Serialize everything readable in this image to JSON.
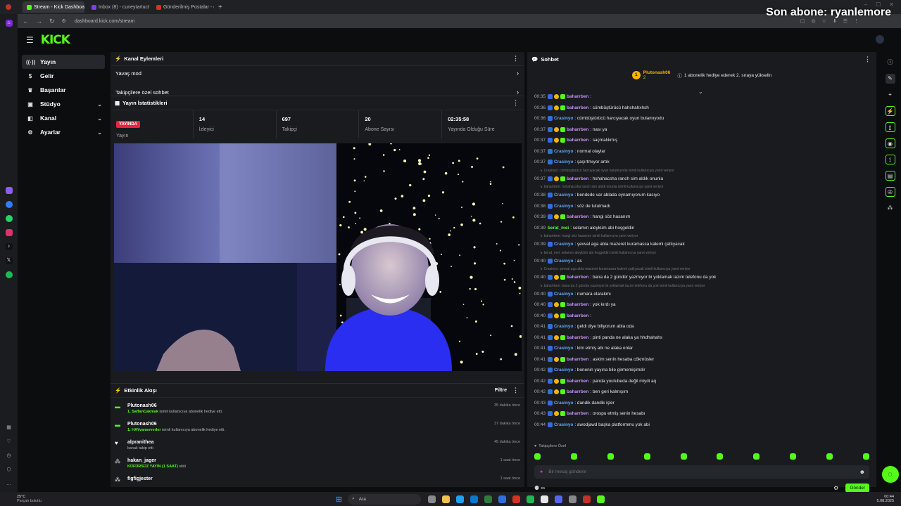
{
  "browser": {
    "tabs": [
      {
        "title": "Stream - Kick Dashboard",
        "color": "#53fc18",
        "active": true
      },
      {
        "title": "Inbox (8) - cuneytartuc81:",
        "color": "#7e3ff2",
        "active": false
      },
      {
        "title": "Gönderilmiş Postalar - cun",
        "color": "#d93025",
        "active": false
      }
    ],
    "url": "dashboard.kick.com/stream"
  },
  "overlay_text": "Son abone: ryanlemore",
  "header": {
    "logo": "KICK"
  },
  "leftnav": {
    "items": [
      {
        "label": "Yayın",
        "icon": "broadcast-icon",
        "active": true
      },
      {
        "label": "Gelir",
        "icon": "revenue-icon"
      },
      {
        "label": "Başarılar",
        "icon": "trophy-icon"
      },
      {
        "label": "Stüdyo",
        "icon": "studio-icon",
        "chevron": true
      },
      {
        "label": "Kanal",
        "icon": "channel-icon",
        "chevron": true
      },
      {
        "label": "Ayarlar",
        "icon": "settings-icon",
        "chevron": true
      }
    ]
  },
  "channel_actions": {
    "title": "Kanal Eylemleri",
    "items": [
      "Yavaş mod",
      "Takipçilere özel sohbet"
    ]
  },
  "stream_stats": {
    "title": "Yayın İstatistikleri",
    "status": "YAYINDA",
    "stats": [
      {
        "value": "",
        "label": "Yayın"
      },
      {
        "value": "14",
        "label": "İzleyici"
      },
      {
        "value": "697",
        "label": "Takipçi"
      },
      {
        "value": "20",
        "label": "Abone Sayısı"
      },
      {
        "value": "02:35:58",
        "label": "Yayında Olduğu Süre"
      }
    ]
  },
  "activity": {
    "title": "Etkinlik Akışı",
    "filter": "Filtre",
    "items": [
      {
        "name": "Plutonash06",
        "desc_strong": "1, SaffanCakmak",
        "desc": " isimli kullanıcıya abonelik hediye etti.",
        "time": "35 dakika önce",
        "icon": "gift-icon"
      },
      {
        "name": "Plutonash06",
        "desc_strong": "1, HAYvanseverler",
        "desc": " isimli kullanıcıya abonelik hediye etti.",
        "time": "37 dakika önce",
        "icon": "gift-icon"
      },
      {
        "name": "alpranithea",
        "desc_strong": "",
        "desc": "kanalı takip etti",
        "time": "45 dakika önce",
        "icon": "heart-icon"
      },
      {
        "name": "hakan_jager",
        "desc_strong": "KÜFÜRSÜZ YAYIN (1 SAAT)",
        "desc": " sildi",
        "time": "1 saat önce",
        "icon": "reward-icon"
      },
      {
        "name": "figfigjester",
        "desc_strong": "",
        "desc": "",
        "time": "1 saat önce",
        "icon": "reward-icon"
      }
    ]
  },
  "chat": {
    "title": "Sohbet",
    "pinned": {
      "rank": "1",
      "name": "Plutonash06",
      "count": "2",
      "text": "1 abonelik hediye ederek 2. sıraya yükselin"
    },
    "colors": {
      "baharrben": "#c690ff",
      "Crasinyo": "#5fa8ff",
      "berat_mei": "#53fc18"
    },
    "lines": [
      {
        "t": "00:35",
        "u": "baharrben",
        "m": ""
      },
      {
        "t": "00:36",
        "u": "baharrben",
        "m": "cümbüştürücü hahshahxhsh"
      },
      {
        "t": "00:36",
        "u": "Crasinyo",
        "m": "cümbüştürücü harcıyacak oyun bulamıyodu"
      },
      {
        "t": "00:37",
        "u": "baharrben",
        "m": "nası ya"
      },
      {
        "t": "00:37",
        "u": "baharrben",
        "m": "saçmalıkmış"
      },
      {
        "t": "00:37",
        "u": "Crasinyo",
        "m": "normal olaylar"
      },
      {
        "t": "00:37",
        "u": "Crasinyo",
        "m": "şaşırtmıyor artık"
      },
      {
        "reply": "Crasinyo: cümbüştürücü harcıyacak oyun bulamıyodu isimli kullanıcıya yanıt veriyor"
      },
      {
        "t": "00:37",
        "u": "baharrben",
        "m": "hshahacsha ranch sim aldık onunla"
      },
      {
        "reply": "baharrben: hshahacsha ranch sim aldık onunla isimli kullanıcıya yanıt veriyor"
      },
      {
        "t": "00:38",
        "u": "Crasinyo",
        "m": "bendede var ablada oynamıyorum kasıyo"
      },
      {
        "t": "00:38",
        "u": "Crasinyo",
        "m": "söz de tutulmadı"
      },
      {
        "t": "00:39",
        "u": "baharrben",
        "m": "hangi söz hasanım"
      },
      {
        "t": "00:39",
        "u": "berat_mei",
        "m": "selamın aleyküm abi hoşgeldin"
      },
      {
        "reply": "baharrben: hangi söz hasanım isimli kullanıcıya yanıt veriyor"
      },
      {
        "t": "00:39",
        "u": "Crasinyo",
        "m": "şevval aga abla mazeret kuramassa kalemi çatlıyacak"
      },
      {
        "reply": "berat_mei: selamın aleyküm abi hoşgeldin isimli kullanıcıya yanıt veriyor"
      },
      {
        "t": "00:40",
        "u": "Crasinyo",
        "m": "as"
      },
      {
        "reply": "Crasinyo: şevval aga abla mazeret kuramassa kalemi çatlıyacak isimli kullanıcıya yanıt veriyor"
      },
      {
        "t": "00:40",
        "u": "baharrben",
        "m": "bana da 2 gündür yazmıyor bi yoklamak lazım telefonu da yok"
      },
      {
        "reply": "baharrben: bana da 2 gündür yazmıyor bi yoklamak lazım telefonu da yok isimli kullanıcıya yanıt veriyor"
      },
      {
        "t": "00:40",
        "u": "Crasinyo",
        "m": "numara olarakmı"
      },
      {
        "t": "00:40",
        "u": "baharrben",
        "m": "yok kırdı ya"
      },
      {
        "t": "00:40",
        "u": "baharrben",
        "m": ""
      },
      {
        "t": "00:41",
        "u": "Crasinyo",
        "m": "geldi diye biliyorum abla oda"
      },
      {
        "t": "00:41",
        "u": "baharrben",
        "m": "pinti panda ne alaka ya hhdhahahs"
      },
      {
        "t": "00:41",
        "u": "Crasinyo",
        "m": "kim etmiş abi ne alaka onlar"
      },
      {
        "t": "00:41",
        "u": "baharrben",
        "m": "askim senin hesaba cökmüsler"
      },
      {
        "t": "00:42",
        "u": "Crasinyo",
        "m": "bonenin yayına bile girmemişimdir"
      },
      {
        "t": "00:42",
        "u": "baharrben",
        "m": "panda youtubeda değil miydi aq"
      },
      {
        "t": "00:42",
        "u": "baharrben",
        "m": "ben geri kalmışım"
      },
      {
        "t": "00:43",
        "u": "Crasinyo",
        "m": "dandik dandik işler"
      },
      {
        "t": "00:43",
        "u": "baharrben",
        "m": "orospu etmiş senin hesabı"
      },
      {
        "t": "00:44",
        "u": "Crasinyo",
        "m": "awodjawd başka platformmu yok abi"
      }
    ],
    "followers_only": "Takipçilere Özel",
    "input_placeholder": "Bir mesaj gönderin",
    "send": "Gönder"
  },
  "taskbar": {
    "weather_temp": "25°C",
    "weather_desc": "Parçalı bulutlu",
    "search": "Ara",
    "time": "00:44",
    "date": "5.08.2025"
  }
}
